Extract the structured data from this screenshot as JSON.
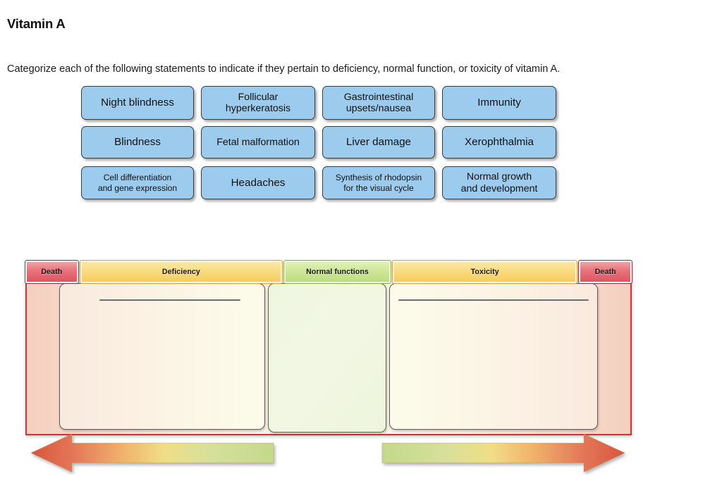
{
  "page": {
    "title": "Vitamin A",
    "instructions": "Categorize each of the following statements to indicate if they pertain to deficiency, normal function, or toxicity of vitamin A."
  },
  "tiles": [
    {
      "id": "night-blindness",
      "label": "Night blindness",
      "size": "lg",
      "col": 0,
      "row": 0
    },
    {
      "id": "follicular",
      "label": "Follicular\nhyperkeratosis",
      "size": "md",
      "col": 1,
      "row": 0
    },
    {
      "id": "gi-upsets",
      "label": "Gastrointestinal\nupsets/nausea",
      "size": "md",
      "col": 2,
      "row": 0
    },
    {
      "id": "immunity",
      "label": "Immunity",
      "size": "lg",
      "col": 3,
      "row": 0
    },
    {
      "id": "blindness",
      "label": "Blindness",
      "size": "lg",
      "col": 0,
      "row": 1
    },
    {
      "id": "fetal-malformation",
      "label": "Fetal malformation",
      "size": "md",
      "col": 1,
      "row": 1
    },
    {
      "id": "liver-damage",
      "label": "Liver damage",
      "size": "lg",
      "col": 2,
      "row": 1
    },
    {
      "id": "xerophthalmia",
      "label": "Xerophthalmia",
      "size": "lg",
      "col": 3,
      "row": 1
    },
    {
      "id": "cell-differentiation",
      "label": "Cell differentiation\nand gene expression",
      "size": "sm",
      "col": 0,
      "row": 2
    },
    {
      "id": "headaches",
      "label": "Headaches",
      "size": "lg",
      "col": 1,
      "row": 2
    },
    {
      "id": "rhodopsin",
      "label": "Synthesis of rhodopsin\nfor the visual cycle",
      "size": "sm",
      "col": 2,
      "row": 2
    },
    {
      "id": "normal-growth",
      "label": "Normal growth\nand development",
      "size": "md",
      "col": 3,
      "row": 2
    }
  ],
  "continuum": {
    "labels": {
      "death_left": "Death",
      "deficiency": "Deficiency",
      "normal_functions": "Normal functions",
      "toxicity": "Toxicity",
      "death_right": "Death"
    },
    "zones": [
      {
        "id": "deficiency-zone",
        "label": "Deficiency",
        "items": [],
        "placeholder_line": true
      },
      {
        "id": "normal-zone",
        "label": "Normal functions",
        "items": [],
        "placeholder_line": false
      },
      {
        "id": "toxicity-zone",
        "label": "Toxicity",
        "items": [],
        "placeholder_line": true
      }
    ]
  },
  "arrows": {
    "left": {
      "direction": "left",
      "name": "decreasing-intake-arrow"
    },
    "right": {
      "direction": "right",
      "name": "increasing-intake-arrow"
    }
  },
  "colors": {
    "tile_fill": "#9ccbed",
    "tile_border": "#3c3c3c",
    "death_bar": "#dd5560",
    "deficiency_bar": "#f6cd5e",
    "normal_bar": "#bcdd7e",
    "toxicity_bar": "#f6cd5e",
    "panel_border": "#c8353f",
    "arrow_tip": "#e06a4c",
    "arrow_tail": "#c6d98c"
  }
}
